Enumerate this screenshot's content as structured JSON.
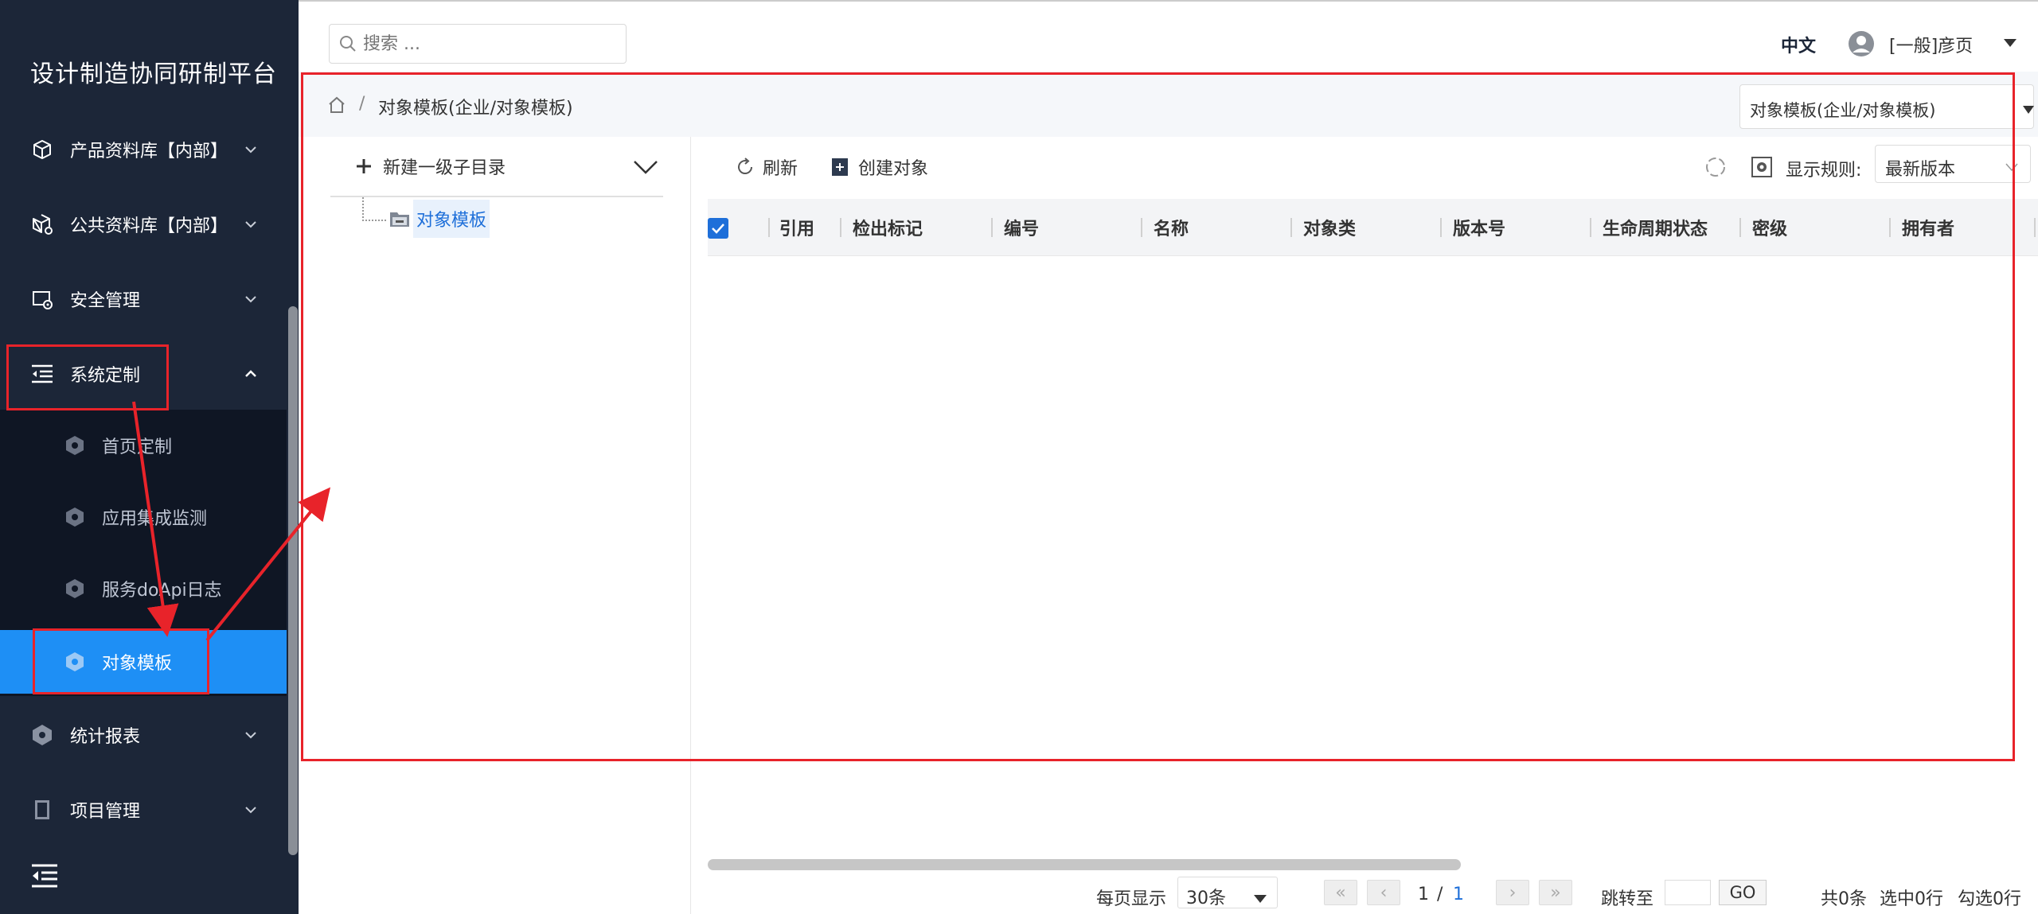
{
  "app": {
    "title": "设计制造协同研制平台"
  },
  "sidebar": {
    "items": [
      {
        "label": "产品资料库【内部】",
        "icon": "cube-icon",
        "expanded": false
      },
      {
        "label": "公共资料库【内部】",
        "icon": "cube-share-icon",
        "expanded": false
      },
      {
        "label": "安全管理",
        "icon": "monitor-gear-icon",
        "expanded": false
      },
      {
        "label": "系统定制",
        "icon": "indent-list-icon",
        "expanded": true
      },
      {
        "label": "统计报表",
        "icon": "hex-icon",
        "expanded": false
      },
      {
        "label": "项目管理",
        "icon": "book-icon",
        "expanded": false
      }
    ],
    "sub_items": [
      {
        "label": "首页定制",
        "active": false
      },
      {
        "label": "应用集成监测",
        "active": false
      },
      {
        "label": "服务doApi日志",
        "active": false
      },
      {
        "label": "对象模板",
        "active": true
      }
    ]
  },
  "header": {
    "search_placeholder": "搜索 ...",
    "language": "中文",
    "user": "[一般]彦页"
  },
  "breadcrumb": {
    "separator": "/",
    "current": "对象模板(企业/对象模板)",
    "select_value": "对象模板(企业/对象模板)"
  },
  "tree": {
    "new_dir_label": "新建一级子目录",
    "node_label": "对象模板"
  },
  "toolbar": {
    "refresh_label": "刷新",
    "create_label": "创建对象",
    "rule_label": "显示规则:",
    "rule_value": "最新版本"
  },
  "table": {
    "columns": [
      "引用",
      "检出标记",
      "编号",
      "名称",
      "对象类",
      "版本号",
      "生命周期状态",
      "密级",
      "拥有者"
    ],
    "rows": []
  },
  "pager": {
    "per_page_label": "每页显示",
    "per_page_value": "30条",
    "first": "«",
    "prev": "‹",
    "next": "›",
    "last": "»",
    "current_page": "1",
    "slash": "/",
    "total_pages": "1",
    "jump_label": "跳转至",
    "go_label": "GO",
    "total": "共0条",
    "selected": "选中0行",
    "checked": "勾选0行"
  },
  "colors": {
    "sidebar_bg": "#1c2638",
    "submenu_bg": "#0f1624",
    "accent": "#1e8ff5",
    "link": "#1e6fd9",
    "annotation": "#e8232a"
  }
}
